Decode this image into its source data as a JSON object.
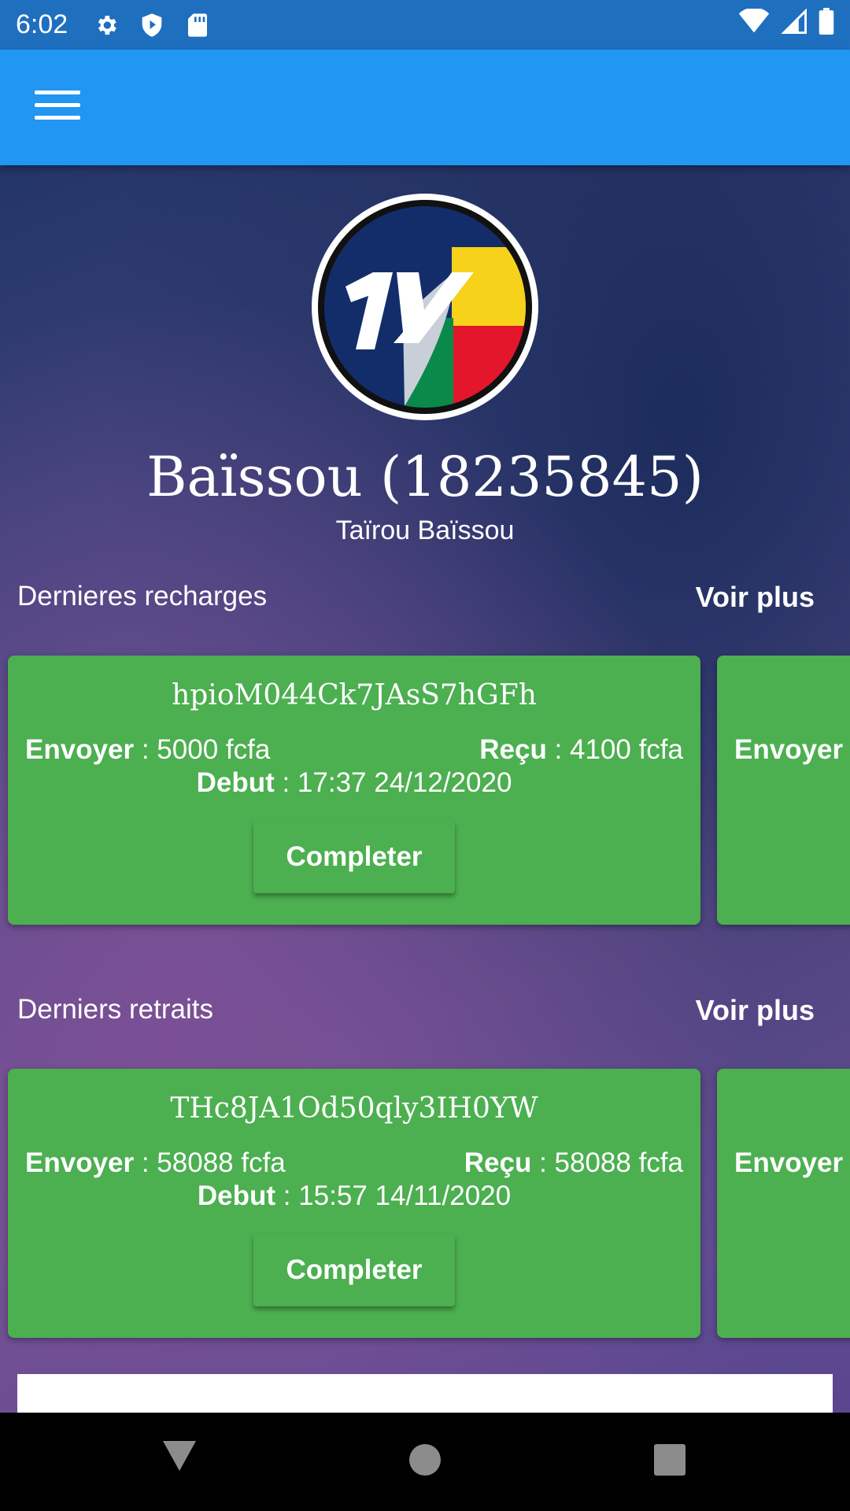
{
  "status_bar": {
    "time": "6:02",
    "icons": [
      "gear-icon",
      "shield-play-icon",
      "sd-card-icon",
      "wifi-icon",
      "signal-icon",
      "battery-icon"
    ]
  },
  "app_bar": {
    "menu_icon": "hamburger-menu-icon",
    "color": "#2196f3"
  },
  "profile": {
    "logo_text": "1Y",
    "name": "Baïssou (18235845)",
    "full_name": "Taïrou Baïssou"
  },
  "recharges": {
    "title": "Dernieres recharges",
    "more": "Voir plus",
    "cards": [
      {
        "code": "hpioM044Ck7JAsS7hGFh",
        "send_label": "Envoyer",
        "send_value": " : 5000 fcfa",
        "recv_label": "Reçu",
        "recv_value": " : 4100 fcfa",
        "debut_label": "Debut",
        "debut_value": " : 17:37  24/12/2020",
        "button": "Completer"
      }
    ],
    "peek": {
      "send_label": "Envoyer",
      "send_value": " :"
    }
  },
  "retraits": {
    "title": "Derniers retraits",
    "more": "Voir plus",
    "cards": [
      {
        "code": "THc8JA1Od50qly3IH0YW",
        "send_label": "Envoyer",
        "send_value": " : 58088 fcfa",
        "recv_label": "Reçu",
        "recv_value": " : 58088 fcfa",
        "debut_label": "Debut",
        "debut_value": " : 15:57  14/11/2020",
        "button": "Completer"
      }
    ],
    "peek": {
      "send_label": "Envoyer",
      "send_value": " :"
    }
  },
  "colors": {
    "status_bar": "#1f6fbf",
    "card": "#4caf50",
    "accent": "#2196f3"
  }
}
